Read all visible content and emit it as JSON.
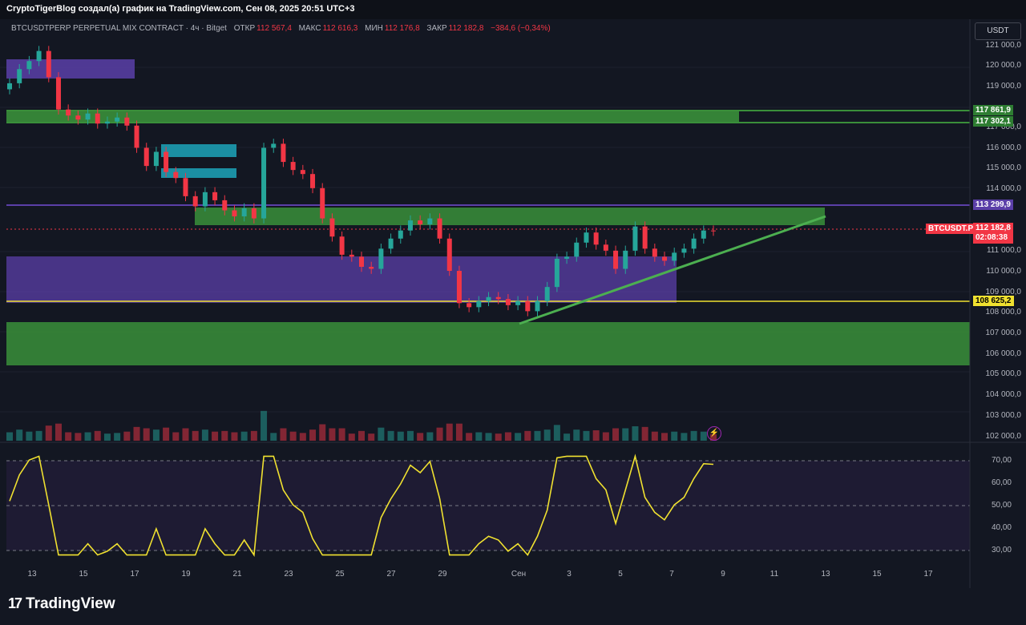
{
  "header": {
    "title": "CryptoTigerBlog создал(а) график на TradingView.com, Сен 08, 2025 20:51 UTC+3"
  },
  "legend": {
    "symbol": "BTCUSDTPERP PERPETUAL MIX CONTRACT · 4ч · Bitget",
    "open_label": "ОТКР",
    "open": "112 567,4",
    "high_label": "МАКС",
    "high": "112 616,3",
    "low_label": "МИН",
    "low": "112 176,8",
    "close_label": "ЗАКР",
    "close": "112 182,8",
    "change": "−384,6 (−0,34%)"
  },
  "currency_button": "USDT",
  "price_axis": {
    "labels": [
      "121 000,0",
      "120 000,0",
      "119 000,0",
      "117 000,0",
      "116 000,0",
      "115 000,0",
      "114 000,0",
      "111 000,0",
      "110 000,0",
      "109 000,0",
      "108 000,0",
      "107 000,0",
      "106 000,0",
      "105 000,0",
      "104 000,0",
      "103 000,0",
      "102 000,0"
    ]
  },
  "tags": {
    "level_1": "117 861,9",
    "level_2": "117 302,1",
    "level_3": "113 299,9",
    "level_4": "108 625,2",
    "last_price": "112 182,8",
    "countdown": "02:08:38",
    "symbol": "BTCUSDT.P"
  },
  "rsi_axis": {
    "labels": [
      "70,00",
      "60,00",
      "50,00",
      "40,00",
      "30,00"
    ]
  },
  "x_axis": {
    "labels": [
      "13",
      "15",
      "17",
      "19",
      "21",
      "23",
      "25",
      "27",
      "29",
      "Сен",
      "3",
      "5",
      "7",
      "9",
      "11",
      "13",
      "15",
      "17"
    ]
  },
  "footer": {
    "brand": "TradingView"
  },
  "colors": {
    "bg": "#131722",
    "green_zone": "#3a8f3a",
    "purple_zone": "#5b3fa8",
    "teal_zone": "#1b8fa3",
    "up": "#26a69a",
    "down": "#f23645",
    "rsi_line": "#f0e130"
  },
  "chart_data": {
    "type": "candlestick",
    "series": [
      {
        "name": "BTCUSDT.P",
        "close": [
          119500,
          120200,
          120600,
          121100,
          119800,
          118200,
          117900,
          117700,
          118000,
          117500,
          117600,
          117800,
          117400,
          116300,
          115400,
          116100,
          115100,
          114800,
          113900,
          113400,
          114100,
          113700,
          113200,
          112900,
          113300,
          112800,
          116300,
          116500,
          115600,
          115200,
          115000,
          114300,
          112800,
          111900,
          111000,
          110900,
          110400,
          110300,
          111300,
          111800,
          112200,
          112700,
          112500,
          112800,
          111800,
          110200,
          108600,
          108400,
          108700,
          108900,
          108800,
          108500,
          108700,
          108200,
          108700,
          109400,
          110800,
          110900,
          111600,
          112100,
          111500,
          111200,
          110300,
          111200,
          112400,
          111300,
          110900,
          110700,
          111100,
          111300,
          111800,
          112200,
          112182.8
        ]
      }
    ],
    "rsi": {
      "ylim": [
        25,
        75
      ],
      "levels": [
        70,
        50,
        30
      ]
    },
    "ylim": [
      101700,
      121800
    ]
  }
}
